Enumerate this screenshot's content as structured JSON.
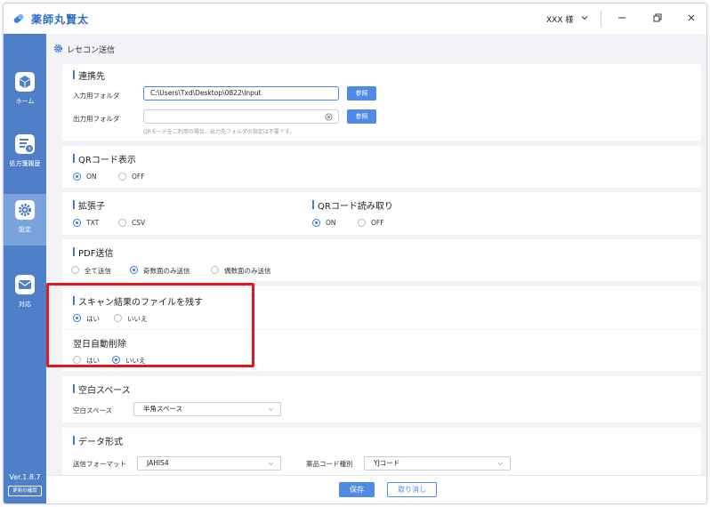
{
  "app": {
    "title": "薬師丸賢太",
    "user_label": "XXX 様"
  },
  "sidebar": {
    "items": [
      {
        "label": "ホーム",
        "icon": "cube-icon"
      },
      {
        "label": "処方箋履歴",
        "icon": "history-icon"
      },
      {
        "label": "設定",
        "icon": "gear-icon",
        "active": true
      },
      {
        "label": "対応",
        "icon": "mail-icon"
      }
    ],
    "version": "Ver.1.8.7",
    "update_label": "更新の確認"
  },
  "page": {
    "title": "レセコン送信"
  },
  "connection": {
    "title": "連携先",
    "input_folder_label": "入力用フォルダ",
    "input_folder_value": "C:\\Users\\Txd\\Desktop\\0822\\Input",
    "output_folder_label": "出力用フォルダ",
    "output_folder_value": "",
    "browse_label": "参照",
    "hint": "QRモードをご利用の場合、出力先フォルダの指定は不要です。"
  },
  "qr_display": {
    "title": "QRコード表示",
    "options": [
      "ON",
      "OFF"
    ],
    "selected": "ON"
  },
  "extension": {
    "title": "拡張子",
    "options": [
      "TXT",
      "CSV"
    ],
    "selected": "TXT"
  },
  "qr_read": {
    "title": "QRコード読み取り",
    "options": [
      "ON",
      "OFF"
    ],
    "selected": "ON"
  },
  "pdf_send": {
    "title": "PDF送信",
    "options": [
      "全て送信",
      "奇数面のみ送信",
      "偶数面のみ送信"
    ],
    "selected": "奇数面のみ送信"
  },
  "scan_keep": {
    "title": "スキャン結果のファイルを残す",
    "options": [
      "はい",
      "いいえ"
    ],
    "selected": "はい"
  },
  "auto_delete": {
    "title": "翌日自動削除",
    "options": [
      "はい",
      "いいえ"
    ],
    "selected": "いいえ"
  },
  "blank_space": {
    "title": "空白スペース",
    "label": "空白スペース",
    "value": "半角スペース"
  },
  "data_format": {
    "title": "データ形式",
    "format_label": "送信フォーマット",
    "format_value": "JAHIS4",
    "code_label": "薬品コード種別",
    "code_value": "YJコード"
  },
  "footer": {
    "save_label": "保存",
    "cancel_label": "取り消し"
  },
  "colors": {
    "sidebar": "#4f7fc9",
    "accent": "#4f8ae6",
    "highlight": "#e4161a"
  }
}
